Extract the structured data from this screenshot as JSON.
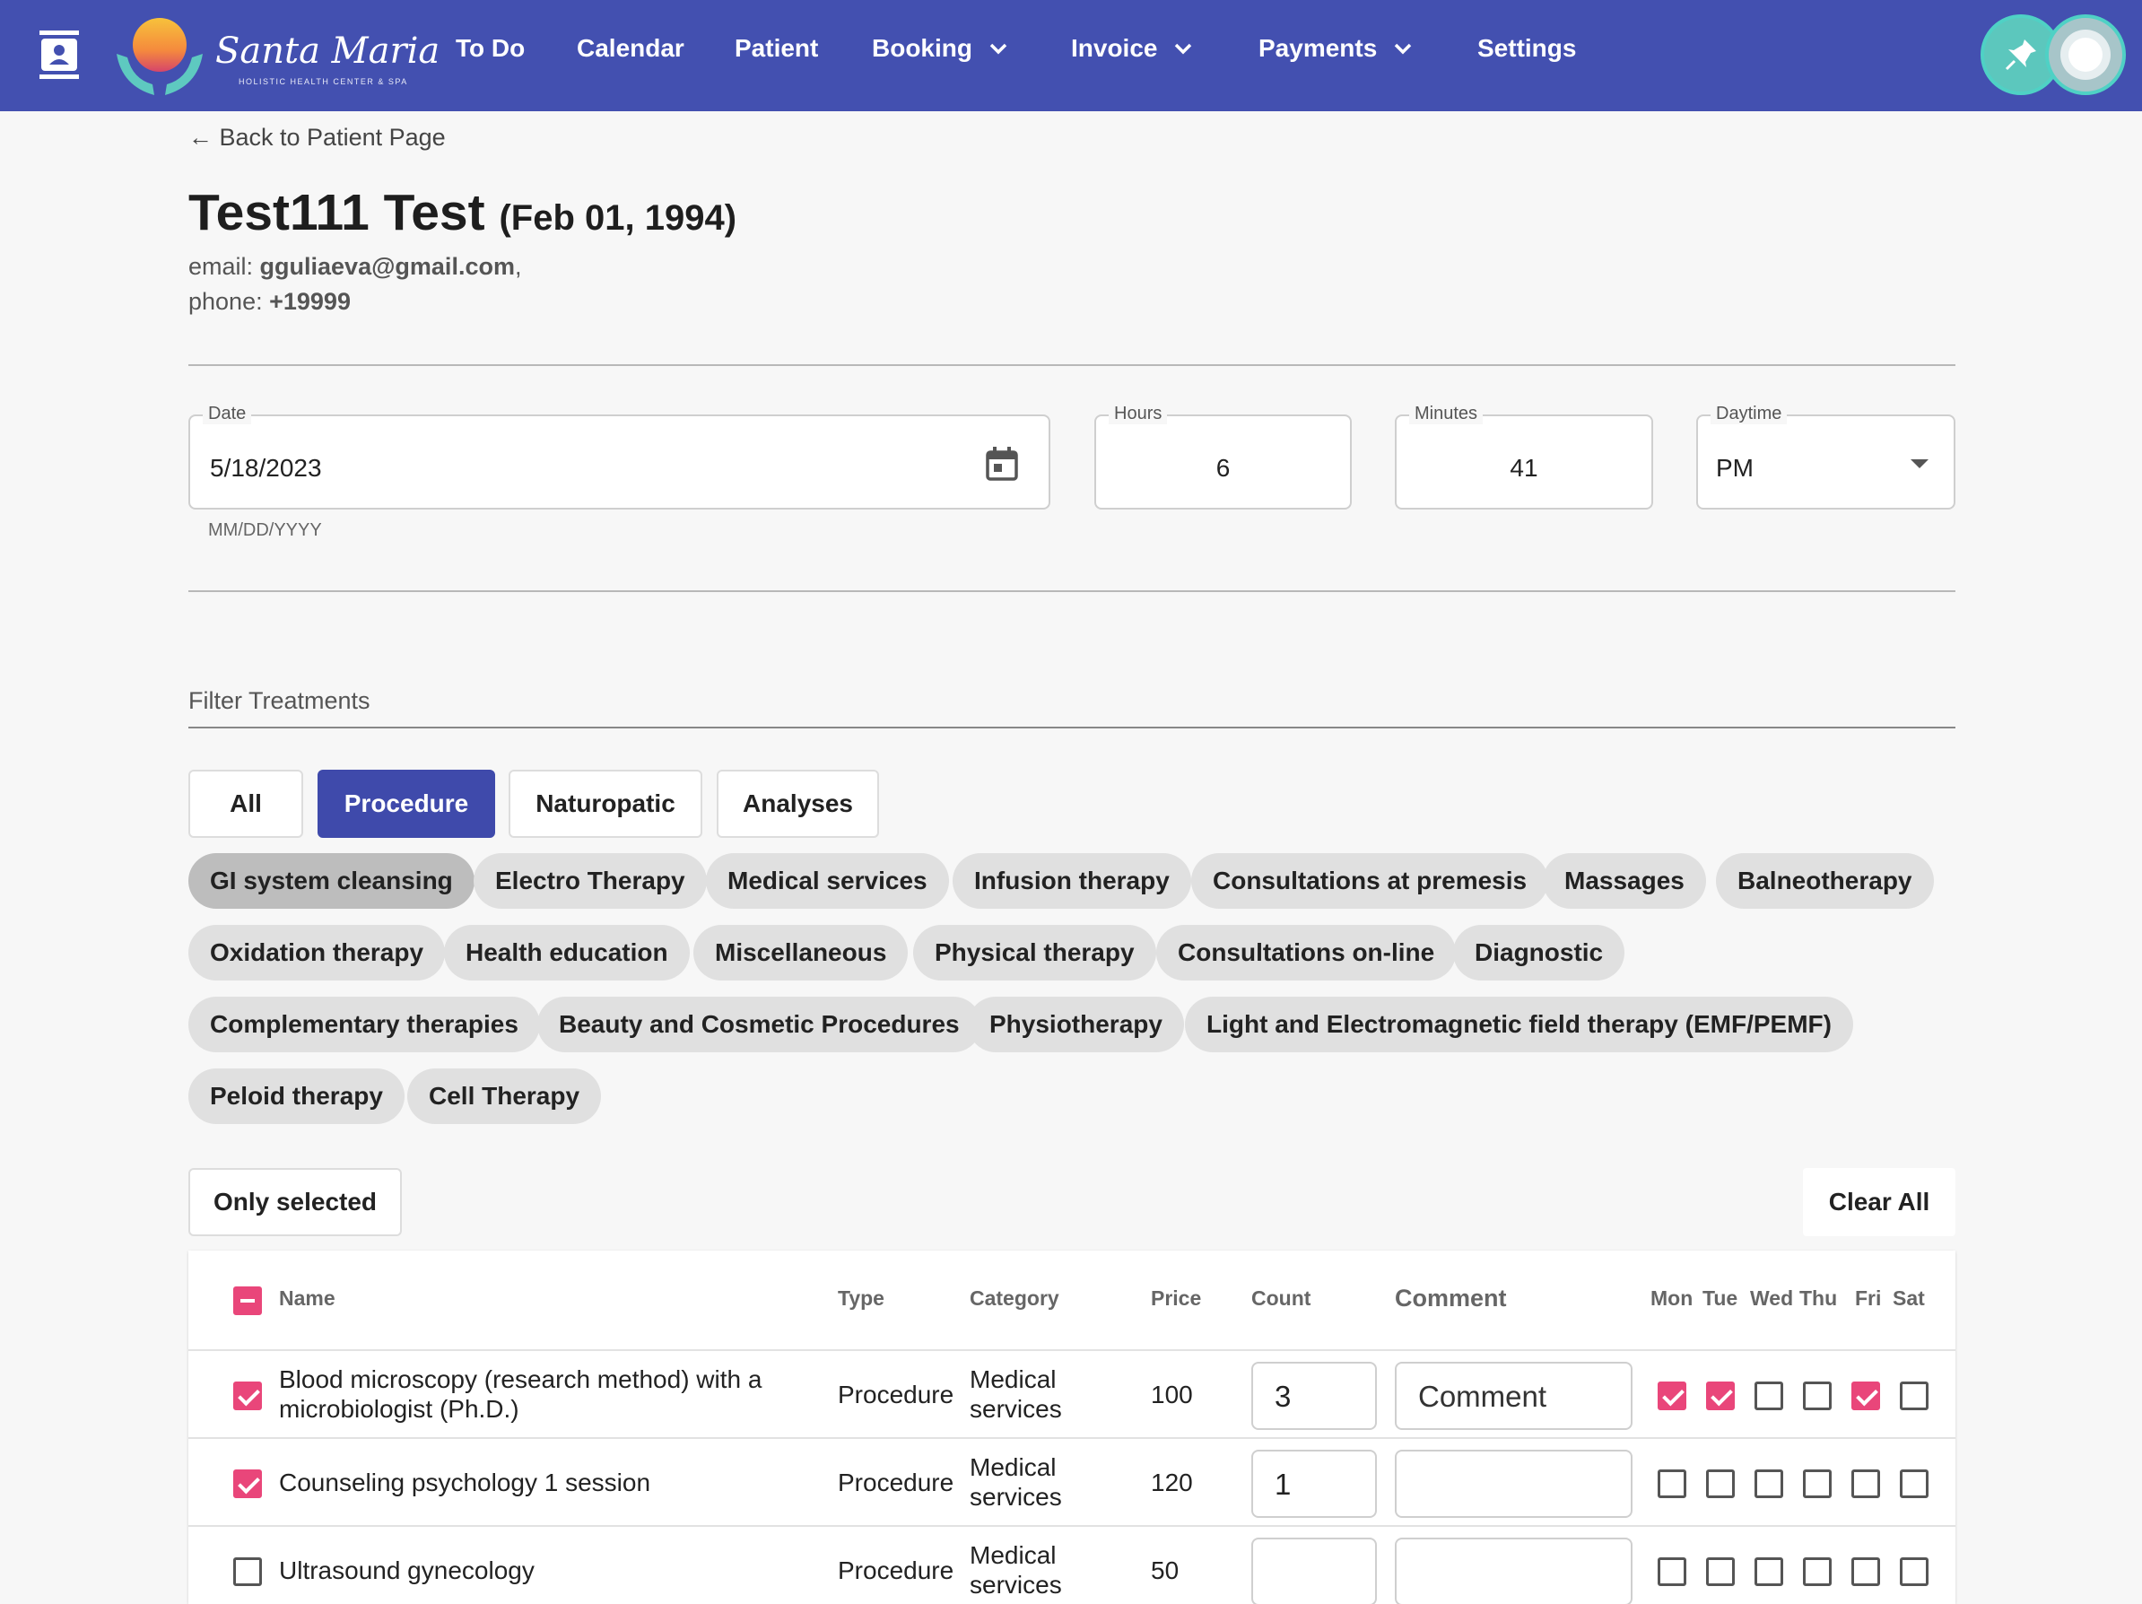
{
  "nav": {
    "brand": "Santa Maria",
    "brand_sub": "HOLISTIC HEALTH CENTER & SPA",
    "items": [
      {
        "label": "To Do"
      },
      {
        "label": "Calendar"
      },
      {
        "label": "Patient"
      },
      {
        "label": "Booking"
      },
      {
        "label": "Invoice"
      },
      {
        "label": "Payments"
      },
      {
        "label": "Settings"
      }
    ],
    "color": "#4350b0"
  },
  "header": {
    "back_label": "← Back to Patient Page",
    "name": "Test111 Test",
    "dob": "(Feb 01, 1994)",
    "email_label": "email:",
    "email": "gguliaeva@gmail.com",
    "email_suffix": ",",
    "phone_label": "phone:",
    "phone": "+19999"
  },
  "form": {
    "date_label": "Date",
    "date_value": "5/18/2023",
    "date_helper": "MM/DD/YYYY",
    "hours_label": "Hours",
    "hours_value": "6",
    "minutes_label": "Minutes",
    "minutes_value": "41",
    "daytime_label": "Daytime",
    "daytime_value": "PM"
  },
  "filter": {
    "label": "Filter Treatments",
    "types": [
      {
        "label": "All",
        "active": false
      },
      {
        "label": "Procedure",
        "active": true
      },
      {
        "label": "Naturopatic",
        "active": false
      },
      {
        "label": "Analyses",
        "active": false
      }
    ],
    "categories": [
      "GI system cleansing",
      "Electro Therapy",
      "Medical services",
      "Infusion therapy",
      "Consultations at premesis",
      "Massages",
      "Balneotherapy",
      "Oxidation therapy",
      "Health education",
      "Miscellaneous",
      "Physical therapy",
      "Consultations on-line",
      "Diagnostic",
      "Complementary therapies",
      "Beauty and Cosmetic Procedures",
      "Physiotherapy",
      "Light and Electromagnetic field therapy (EMF/PEMF)",
      "Peloid therapy",
      "Cell Therapy"
    ],
    "selected_category": "GI system cleansing",
    "only_selected_label": "Only selected",
    "clear_all_label": "Clear All"
  },
  "table": {
    "headers": {
      "name": "Name",
      "type": "Type",
      "category": "Category",
      "price": "Price",
      "count": "Count",
      "comment": "Comment",
      "days": [
        "Mon",
        "Tue",
        "Wed",
        "Thu",
        "Fri",
        "Sat"
      ]
    },
    "rows": [
      {
        "selected": true,
        "name_line1": "Blood microscopy (research method) with a",
        "name_line2": "microbiologist (Ph.D.)",
        "type": "Procedure",
        "category_line1": "Medical",
        "category_line2": "services",
        "price": "100",
        "count": "3",
        "comment": "",
        "comment_placeholder": "Comment",
        "days": [
          true,
          true,
          false,
          false,
          true,
          false
        ]
      },
      {
        "selected": true,
        "name_line1": "Counseling psychology 1 session",
        "name_line2": "",
        "type": "Procedure",
        "category_line1": "Medical",
        "category_line2": "services",
        "price": "120",
        "count": "1",
        "comment": "",
        "comment_placeholder": "",
        "days": [
          false,
          false,
          false,
          false,
          false,
          false
        ]
      },
      {
        "selected": false,
        "name_line1": "Ultrasound gynecology",
        "name_line2": "",
        "type": "Procedure",
        "category_line1": "Medical",
        "category_line2": "services",
        "price": "50",
        "count": "",
        "comment": "",
        "comment_placeholder": "",
        "days": [
          false,
          false,
          false,
          false,
          false,
          false
        ]
      }
    ],
    "accent": "#e9467a"
  }
}
